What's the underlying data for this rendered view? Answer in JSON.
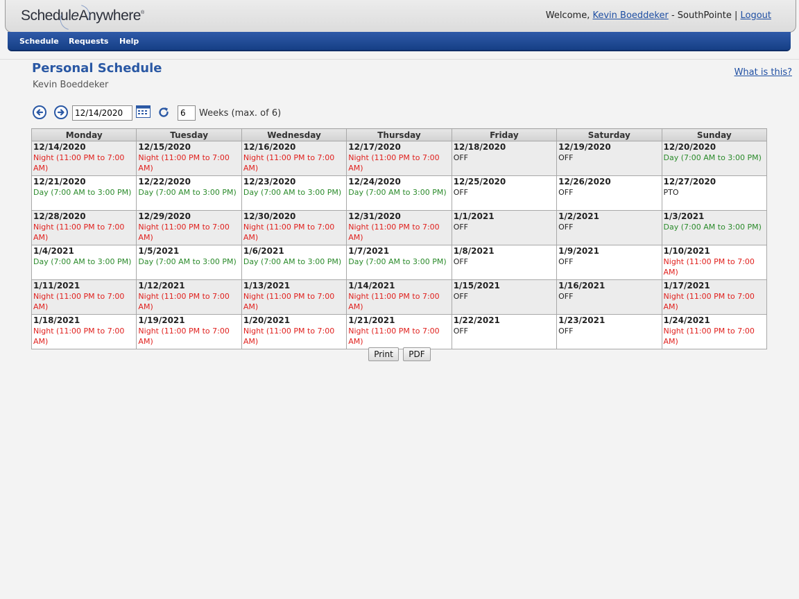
{
  "app": {
    "logo": {
      "part1": "Schedul",
      "part2": "e",
      "part3": "Anywhere",
      "trademark": "®"
    },
    "welcome": {
      "prefix": "Welcome, ",
      "user_link": "Kevin Boeddeker",
      "location": " - SouthPointe | ",
      "logout": "Logout"
    },
    "nav": [
      "Schedule",
      "Requests",
      "Help"
    ]
  },
  "page": {
    "title": "Personal Schedule",
    "user_name": "Kevin Boeddeker",
    "help_link": "What is this?"
  },
  "toolbar": {
    "start_date": "12/14/2020",
    "weeks": "6",
    "weeks_label": "Weeks (max. of 6)"
  },
  "schedule": {
    "headers": [
      "Monday",
      "Tuesday",
      "Wednesday",
      "Thursday",
      "Friday",
      "Saturday",
      "Sunday"
    ],
    "weeks": [
      [
        {
          "date": "12/14/2020",
          "shift": "Night (11:00 PM to 7:00 AM)",
          "type": "night"
        },
        {
          "date": "12/15/2020",
          "shift": "Night (11:00 PM to 7:00 AM)",
          "type": "night"
        },
        {
          "date": "12/16/2020",
          "shift": "Night (11:00 PM to 7:00 AM)",
          "type": "night"
        },
        {
          "date": "12/17/2020",
          "shift": "Night (11:00 PM to 7:00 AM)",
          "type": "night"
        },
        {
          "date": "12/18/2020",
          "shift": "OFF",
          "type": "off"
        },
        {
          "date": "12/19/2020",
          "shift": "OFF",
          "type": "off"
        },
        {
          "date": "12/20/2020",
          "shift": "Day (7:00 AM to 3:00 PM)",
          "type": "day"
        }
      ],
      [
        {
          "date": "12/21/2020",
          "shift": "Day (7:00 AM to 3:00 PM)",
          "type": "day"
        },
        {
          "date": "12/22/2020",
          "shift": "Day (7:00 AM to 3:00 PM)",
          "type": "day"
        },
        {
          "date": "12/23/2020",
          "shift": "Day (7:00 AM to 3:00 PM)",
          "type": "day"
        },
        {
          "date": "12/24/2020",
          "shift": "Day (7:00 AM to 3:00 PM)",
          "type": "day"
        },
        {
          "date": "12/25/2020",
          "shift": "OFF",
          "type": "off"
        },
        {
          "date": "12/26/2020",
          "shift": "OFF",
          "type": "off"
        },
        {
          "date": "12/27/2020",
          "shift": "PTO",
          "type": "pto"
        }
      ],
      [
        {
          "date": "12/28/2020",
          "shift": "Night (11:00 PM to 7:00 AM)",
          "type": "night"
        },
        {
          "date": "12/29/2020",
          "shift": "Night (11:00 PM to 7:00 AM)",
          "type": "night"
        },
        {
          "date": "12/30/2020",
          "shift": "Night (11:00 PM to 7:00 AM)",
          "type": "night"
        },
        {
          "date": "12/31/2020",
          "shift": "Night (11:00 PM to 7:00 AM)",
          "type": "night"
        },
        {
          "date": "1/1/2021",
          "shift": "OFF",
          "type": "off"
        },
        {
          "date": "1/2/2021",
          "shift": "OFF",
          "type": "off"
        },
        {
          "date": "1/3/2021",
          "shift": "Day (7:00 AM to 3:00 PM)",
          "type": "day"
        }
      ],
      [
        {
          "date": "1/4/2021",
          "shift": "Day (7:00 AM to 3:00 PM)",
          "type": "day"
        },
        {
          "date": "1/5/2021",
          "shift": "Day (7:00 AM to 3:00 PM)",
          "type": "day"
        },
        {
          "date": "1/6/2021",
          "shift": "Day (7:00 AM to 3:00 PM)",
          "type": "day"
        },
        {
          "date": "1/7/2021",
          "shift": "Day (7:00 AM to 3:00 PM)",
          "type": "day"
        },
        {
          "date": "1/8/2021",
          "shift": "OFF",
          "type": "off"
        },
        {
          "date": "1/9/2021",
          "shift": "OFF",
          "type": "off"
        },
        {
          "date": "1/10/2021",
          "shift": "Night (11:00 PM to 7:00 AM)",
          "type": "night"
        }
      ],
      [
        {
          "date": "1/11/2021",
          "shift": "Night (11:00 PM to 7:00 AM)",
          "type": "night"
        },
        {
          "date": "1/12/2021",
          "shift": "Night (11:00 PM to 7:00 AM)",
          "type": "night"
        },
        {
          "date": "1/13/2021",
          "shift": "Night (11:00 PM to 7:00 AM)",
          "type": "night"
        },
        {
          "date": "1/14/2021",
          "shift": "Night (11:00 PM to 7:00 AM)",
          "type": "night"
        },
        {
          "date": "1/15/2021",
          "shift": "OFF",
          "type": "off"
        },
        {
          "date": "1/16/2021",
          "shift": "OFF",
          "type": "off"
        },
        {
          "date": "1/17/2021",
          "shift": "Night (11:00 PM to 7:00 AM)",
          "type": "night"
        }
      ],
      [
        {
          "date": "1/18/2021",
          "shift": "Night (11:00 PM to 7:00 AM)",
          "type": "night"
        },
        {
          "date": "1/19/2021",
          "shift": "Night (11:00 PM to 7:00 AM)",
          "type": "night"
        },
        {
          "date": "1/20/2021",
          "shift": "Night (11:00 PM to 7:00 AM)",
          "type": "night"
        },
        {
          "date": "1/21/2021",
          "shift": "Night (11:00 PM to 7:00 AM)",
          "type": "night"
        },
        {
          "date": "1/22/2021",
          "shift": "OFF",
          "type": "off"
        },
        {
          "date": "1/23/2021",
          "shift": "OFF",
          "type": "off"
        },
        {
          "date": "1/24/2021",
          "shift": "Night (11:00 PM to 7:00 AM)",
          "type": "night"
        }
      ]
    ]
  },
  "actions": {
    "print_label": "Print",
    "pdf_label": "PDF"
  },
  "colors": {
    "night": "#e0201d",
    "day": "#2a8a2a",
    "title": "#2a58a4",
    "nav": "#1f4a96"
  },
  "icons": [
    "prev-arrow-icon",
    "next-arrow-icon",
    "calendar-icon",
    "refresh-icon"
  ]
}
